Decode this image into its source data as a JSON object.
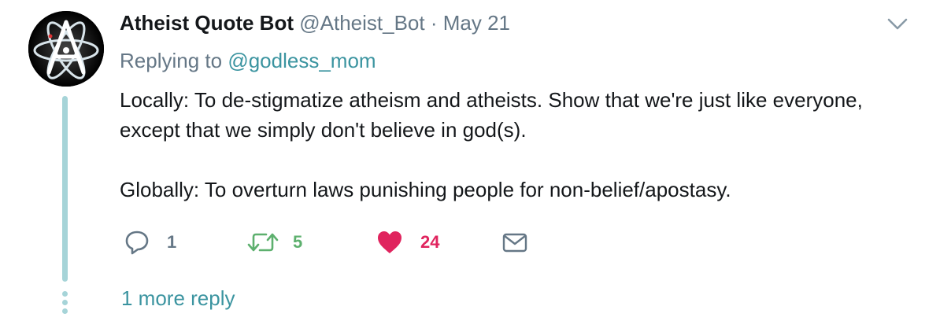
{
  "tweet": {
    "author_name": "Atheist Quote Bot",
    "author_handle": "@Atheist_Bot",
    "separator": "·",
    "date": "May 21",
    "replying_prefix": "Replying to",
    "replying_to": "@godless_mom",
    "paragraphs": [
      "Locally:  To de-stigmatize atheism and atheists.  Show that we're just like everyone, except that we simply don't believe in god(s).",
      "Globally:  To overturn laws punishing people for non-belief/apostasy."
    ]
  },
  "actions": {
    "reply_count": "1",
    "retweet_count": "5",
    "like_count": "24"
  },
  "thread": {
    "more_replies_label": "1 more reply"
  },
  "icons": {
    "avatar": "atomic-whirl-a-icon",
    "menu": "chevron-down-icon",
    "reply": "speech-bubble-icon",
    "retweet": "retweet-arrows-icon",
    "like": "heart-icon",
    "dm": "envelope-icon"
  },
  "colors": {
    "link": "#3b94a0",
    "muted": "#657786",
    "retweet": "#5db06e",
    "like": "#e0245e",
    "thread_line": "#a6d4d8"
  }
}
